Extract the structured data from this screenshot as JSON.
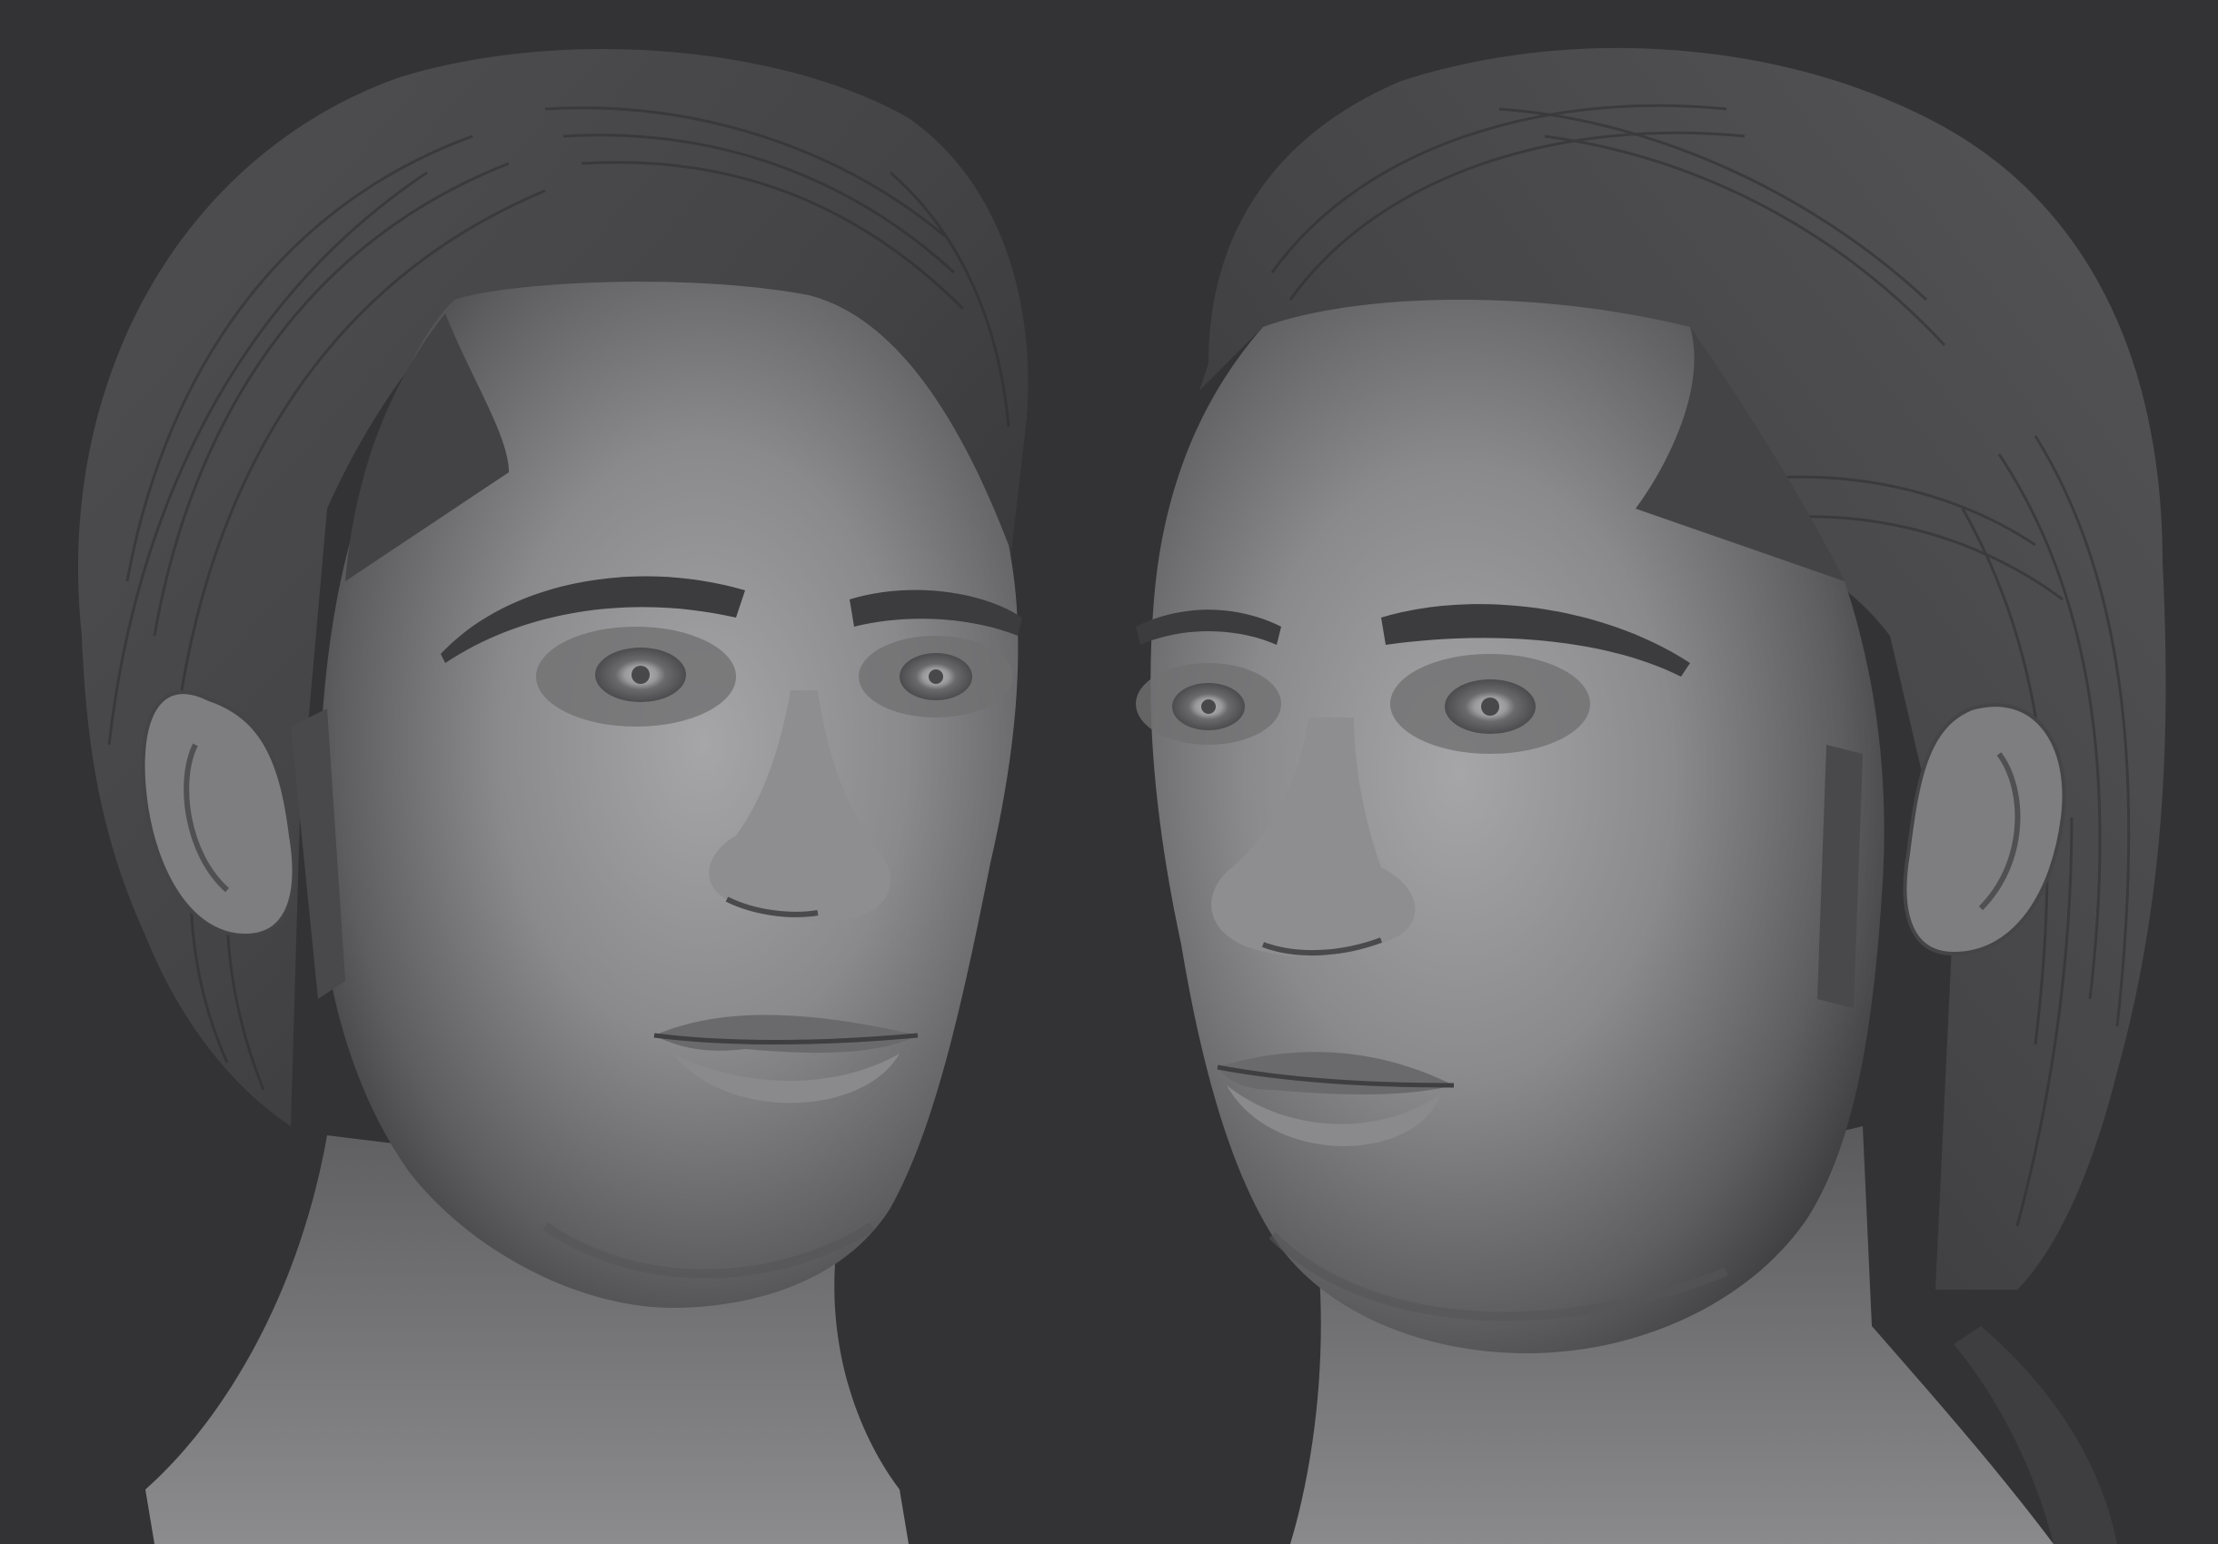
{
  "scene": {
    "background_color": "#333335",
    "clay_highlight": "#a9a9ab",
    "clay_mid": "#7a7a7c",
    "clay_shadow": "#3a3a3c",
    "hair_color": "#4a4a4c",
    "views": [
      {
        "view": "three-quarter-right",
        "icon": "sculpted-head"
      },
      {
        "view": "three-quarter-left",
        "icon": "sculpted-head"
      }
    ]
  }
}
